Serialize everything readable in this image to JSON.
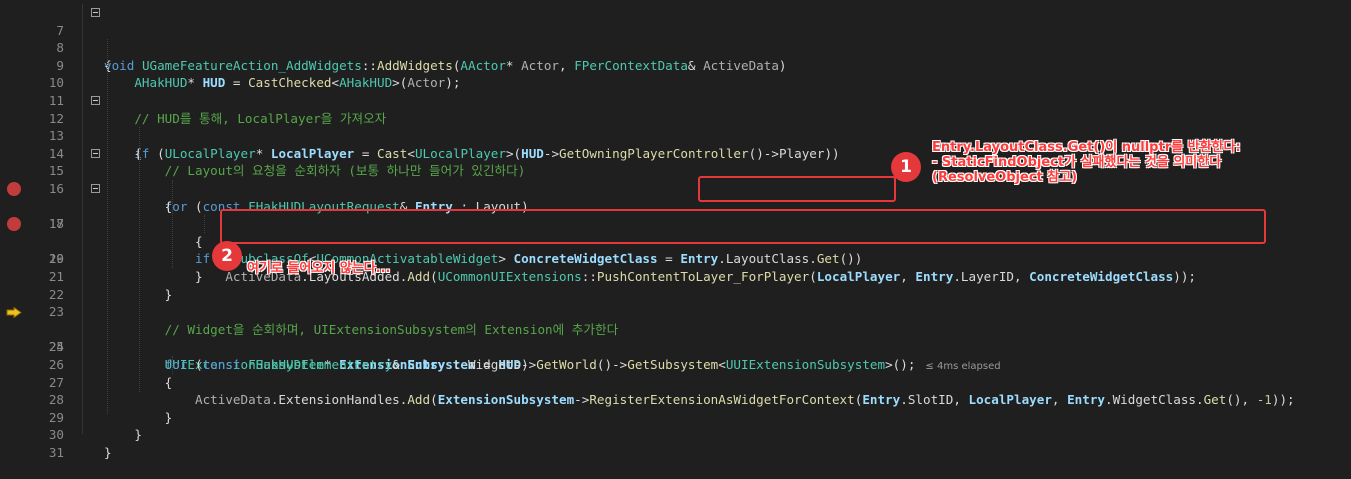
{
  "editor": {
    "lines": [
      {
        "num": "7"
      },
      {
        "num": "8"
      },
      {
        "num": "9"
      },
      {
        "num": "10"
      },
      {
        "num": "11"
      },
      {
        "num": "12"
      },
      {
        "num": "13"
      },
      {
        "num": "14"
      },
      {
        "num": "15"
      },
      {
        "num": "16"
      },
      {
        "num": "17"
      },
      {
        "num": "18"
      },
      {
        "num": "19"
      },
      {
        "num": "20"
      },
      {
        "num": "21"
      },
      {
        "num": "22"
      },
      {
        "num": "23"
      },
      {
        "num": "24"
      },
      {
        "num": "25"
      },
      {
        "num": "26"
      },
      {
        "num": "27"
      },
      {
        "num": "28"
      },
      {
        "num": "29"
      },
      {
        "num": "30"
      },
      {
        "num": "31"
      }
    ],
    "elapsed_hint": "≤ 4ms elapsed"
  },
  "annotations": {
    "badge1": "1",
    "badge2": "2",
    "note1_line1": "Entry.LayoutClass.Get()이 nullptr를 반환한다:",
    "note1_line2": "- StaticFindObject가 실패했다는 것을 의미한다",
    "note1_line3": "(ResolveObject 참고)",
    "note2": "여기로 들어오지 않는다...",
    "color": "#e5383b"
  },
  "colors": {
    "background": "#1f1f1f",
    "keyword": "#569cd6",
    "type": "#4ec9b0",
    "function": "#dcdcaa",
    "comment": "#57a64a"
  }
}
